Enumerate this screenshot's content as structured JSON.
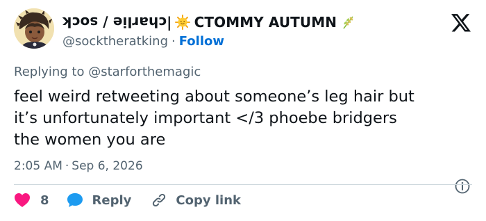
{
  "author": {
    "name_upside_down": "charlie / sock",
    "name_separator": " |",
    "name_main": "CTOMMY AUTUMN",
    "handle": "@socktheratking",
    "follow_label": "Follow",
    "sun_icon": "sun-emoji-icon",
    "plant_icon": "wheat-emoji-icon"
  },
  "tweet": {
    "replying_prefix": "Replying to",
    "replying_to": "@starforthemagic",
    "text_lines": [
      "feel weird retweeting about someone’s leg hair but",
      "it’s unfortunately important </3 phoebe bridgers",
      "the women you are"
    ],
    "time": "2:05 AM",
    "date": "Sep 6, 2026"
  },
  "actions": {
    "likes_count": "8",
    "reply_label": "Reply",
    "copy_link_label": "Copy link"
  },
  "colors": {
    "text": "#0f1419",
    "secondary": "#536471",
    "link": "#006fd6",
    "heart": "#f91880",
    "reply_bubble": "#1d9bf0",
    "divider": "#cfd9de"
  }
}
